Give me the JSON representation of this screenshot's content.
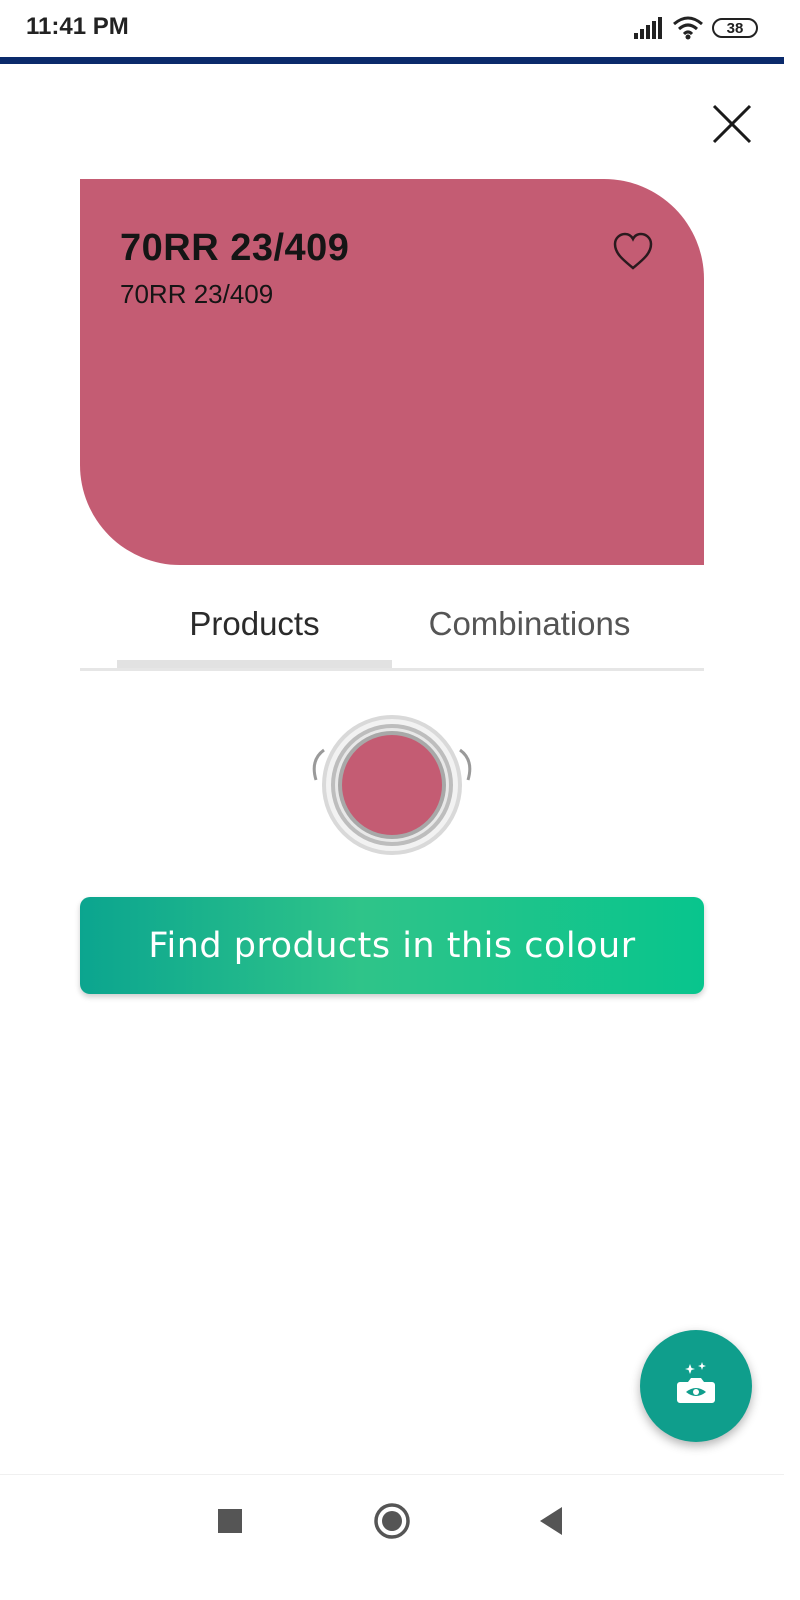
{
  "status_bar": {
    "time": "11:41 PM",
    "battery": "38",
    "icons": [
      "signal-icon",
      "wifi-icon",
      "battery-icon"
    ]
  },
  "colors": {
    "swatch": "#c45c73",
    "accent_start": "#0ba58f",
    "accent_end": "#08c58d",
    "fab": "#0f9e8c",
    "top_rule": "#0a2a6b"
  },
  "swatch": {
    "name": "70RR 23/409",
    "code": "70RR 23/409"
  },
  "tabs": [
    {
      "label": "Products",
      "active": true
    },
    {
      "label": "Combinations",
      "active": false
    }
  ],
  "cta": {
    "label": "Find products in this colour"
  },
  "icons": {
    "close": "close-icon",
    "favorite": "heart-outline-icon",
    "fab": "camera-visualize-icon",
    "nav": [
      "recents-square-icon",
      "home-circle-icon",
      "back-triangle-icon"
    ]
  }
}
